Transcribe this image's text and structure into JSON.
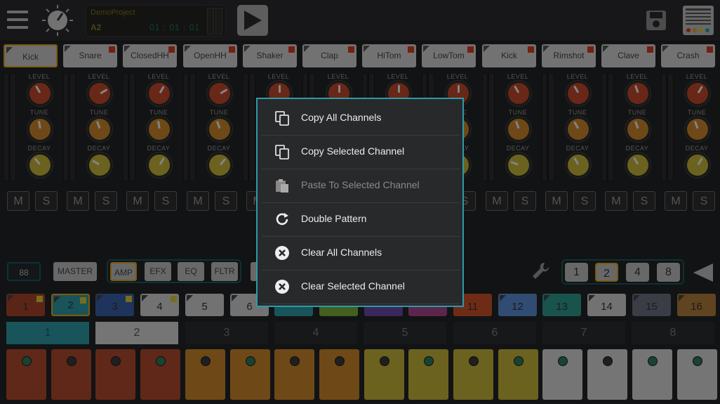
{
  "header": {
    "project_name": "DemoProject",
    "pattern_label": "A2",
    "time_display": "01 : 01 : 01"
  },
  "channels": [
    {
      "name": "Kick",
      "level_angle": -30,
      "tune_angle": -10,
      "decay_angle": -40,
      "selected": true
    },
    {
      "name": "Snare",
      "level_angle": 60,
      "tune_angle": -20,
      "decay_angle": -60
    },
    {
      "name": "ClosedHH",
      "level_angle": 30,
      "tune_angle": -10,
      "decay_angle": 30
    },
    {
      "name": "OpenHH",
      "level_angle": 60,
      "tune_angle": -20,
      "decay_angle": 40
    },
    {
      "name": "Shaker",
      "level_angle": 0,
      "tune_angle": 0,
      "decay_angle": 0
    },
    {
      "name": "Clap",
      "level_angle": 0,
      "tune_angle": 0,
      "decay_angle": 0
    },
    {
      "name": "HiTom",
      "level_angle": 0,
      "tune_angle": 0,
      "decay_angle": 0
    },
    {
      "name": "LowTom",
      "level_angle": 0,
      "tune_angle": 0,
      "decay_angle": 0
    },
    {
      "name": "Kick",
      "level_angle": -30,
      "tune_angle": -20,
      "decay_angle": -70
    },
    {
      "name": "Rimshot",
      "level_angle": -30,
      "tune_angle": -30,
      "decay_angle": -30
    },
    {
      "name": "Clave",
      "level_angle": -20,
      "tune_angle": -20,
      "decay_angle": -30
    },
    {
      "name": "Crash",
      "level_angle": 30,
      "tune_angle": -20,
      "decay_angle": 30
    }
  ],
  "knob_labels": {
    "level": "LEVEL",
    "tune": "TUNE",
    "decay": "DECAY"
  },
  "mute_label": "M",
  "solo_label": "S",
  "controls": {
    "tempo": "88",
    "master": "MASTER",
    "tabs": [
      "AMP",
      "EFX",
      "EQ",
      "FLTR"
    ],
    "step_sizes": [
      "1",
      "2",
      "4",
      "8"
    ]
  },
  "patterns": [
    {
      "label": "1",
      "color": "#a5442a",
      "flag": true
    },
    {
      "label": "2",
      "color": "#2f9aa6",
      "flag": true,
      "selected": true
    },
    {
      "label": "3",
      "color": "#3a5fa8",
      "flag": true
    },
    {
      "label": "4",
      "color": "#cfcfcf",
      "flag": true
    },
    {
      "label": "5",
      "color": "#cfcfcf"
    },
    {
      "label": "6",
      "color": "#cfcfcf"
    },
    {
      "label": "",
      "color": "#2f9aa6"
    },
    {
      "label": "",
      "color": "#7ab03a"
    },
    {
      "label": "",
      "color": "#6b4aa8"
    },
    {
      "label": "",
      "color": "#a8468a"
    },
    {
      "label": "11",
      "color": "#c8502a"
    },
    {
      "label": "12",
      "color": "#5a8ad0"
    },
    {
      "label": "13",
      "color": "#2f9a8a"
    },
    {
      "label": "14",
      "color": "#cfcfcf"
    },
    {
      "label": "15",
      "color": "#6a6f80"
    },
    {
      "label": "16",
      "color": "#b07a3a"
    }
  ],
  "bars": [
    "1",
    "2",
    "3",
    "4",
    "5",
    "6",
    "7",
    "8"
  ],
  "pads": [
    {
      "color": "#b0492c",
      "dot": "#2f7a5a"
    },
    {
      "color": "#b0492c",
      "dot": "#3a3a3a"
    },
    {
      "color": "#b0492c",
      "dot": "#3a3a3a"
    },
    {
      "color": "#b0492c",
      "dot": "#2f7a5a"
    },
    {
      "color": "#c8862a",
      "dot": "#3a3a3a"
    },
    {
      "color": "#c8862a",
      "dot": "#2f7a5a"
    },
    {
      "color": "#c8862a",
      "dot": "#3a3a3a"
    },
    {
      "color": "#c8862a",
      "dot": "#3a3a3a"
    },
    {
      "color": "#c4b23a",
      "dot": "#3a3a3a"
    },
    {
      "color": "#c4b23a",
      "dot": "#2f7a5a"
    },
    {
      "color": "#c4b23a",
      "dot": "#3a3a3a"
    },
    {
      "color": "#c4b23a",
      "dot": "#2f7a5a"
    },
    {
      "color": "#d6d6d6",
      "dot": "#2f7a5a"
    },
    {
      "color": "#d6d6d6",
      "dot": "#3a3a3a"
    },
    {
      "color": "#d6d6d6",
      "dot": "#2f7a5a"
    },
    {
      "color": "#d6d6d6",
      "dot": "#2f7a5a"
    }
  ],
  "context_menu": {
    "items": [
      {
        "label": "Copy All Channels",
        "icon": "copy-icon",
        "enabled": true
      },
      {
        "label": "Copy Selected Channel",
        "icon": "copy-icon",
        "enabled": true
      },
      {
        "label": "Paste To Selected Channel",
        "icon": "paste-icon",
        "enabled": false
      },
      {
        "label": "Double Pattern",
        "icon": "refresh-icon",
        "enabled": true
      },
      {
        "label": "Clear All Channels",
        "icon": "clear-icon",
        "enabled": true
      },
      {
        "label": "Clear Selected Channel",
        "icon": "clear-icon",
        "enabled": true
      }
    ]
  },
  "colors": {
    "accent": "#2e9aa9",
    "select": "#e0a51e",
    "led": "#d23a1f"
  }
}
